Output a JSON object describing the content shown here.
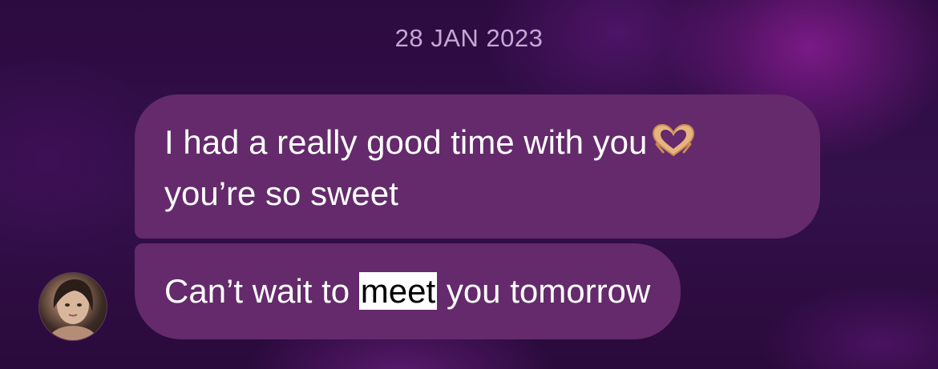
{
  "date_separator": "28 JAN 2023",
  "messages": [
    {
      "line1": "I had a really good time with you",
      "emoji": "heart-hands-emoji",
      "line2": "you’re so sweet"
    },
    {
      "before": "Can’t wait to ",
      "selected": "meet",
      "after": " you tomorrow"
    }
  ],
  "colors": {
    "bubble": "#642a6b",
    "date": "#c6a7d6",
    "selection": "#ffffff"
  }
}
